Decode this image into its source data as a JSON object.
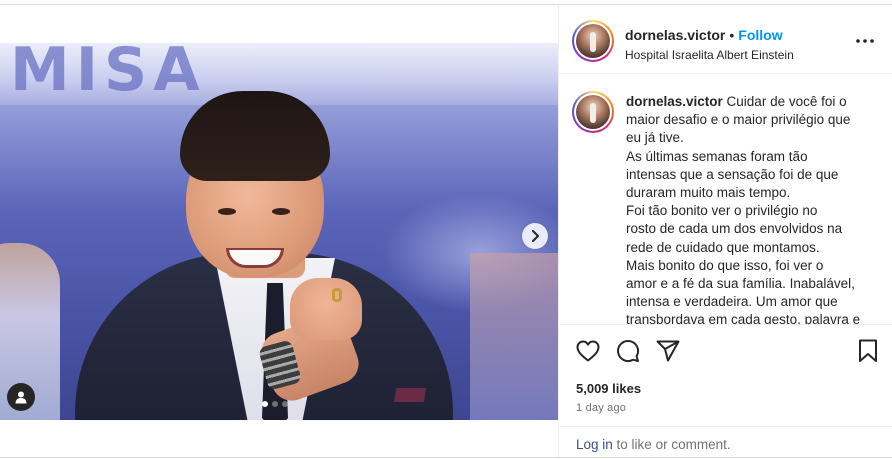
{
  "post": {
    "media": {
      "banner_text": "MISA",
      "carousel_dots": [
        true,
        false,
        false
      ],
      "icons": {
        "next": "chevron-right-icon",
        "tag": "user-tag-icon"
      }
    },
    "header": {
      "username": "dornelas.victor",
      "separator": "•",
      "follow_label": "Follow",
      "location": "Hospital Israelita Albert Einstein",
      "more_label": "•••"
    },
    "caption": {
      "username": "dornelas.victor",
      "lines": [
        "Cuidar de você foi o",
        "maior desafio e o maior privilégio que",
        "eu já tive.",
        "As últimas semanas foram tão",
        "intensas que a sensação foi de que",
        "duraram muito mais tempo.",
        "Foi tão bonito ver o privilégio no",
        "rosto de cada um dos envolvidos na",
        "rede de cuidado que montamos.",
        "Mais bonito do que isso, foi ver o",
        "amor e a fé da sua família. Inabalável,",
        "intensa e verdadeira. Um amor que",
        "transbordava em cada gesto, palavra e"
      ]
    },
    "actions": {
      "icons": [
        "heart-icon",
        "comment-icon",
        "share-icon",
        "bookmark-icon"
      ],
      "likes": "5,009 likes",
      "time": "1 day ago",
      "login_link": "Log in",
      "login_rest": " to like or comment."
    },
    "colors": {
      "link_blue": "#0095f6",
      "text": "#262626",
      "muted": "#737373",
      "login_link": "#385185"
    }
  }
}
